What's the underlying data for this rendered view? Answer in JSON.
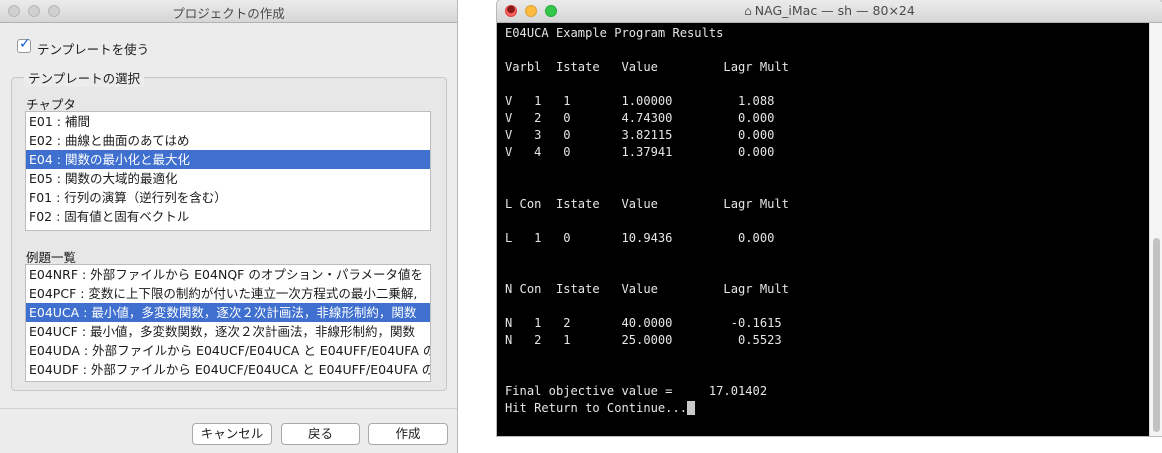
{
  "dialog": {
    "title": "プロジェクトの作成",
    "use_template_label": "テンプレートを使う",
    "use_template_checked": true,
    "template_group_title": "テンプレートの選択",
    "chapter_label": "チャプタ",
    "chapters": [
      "E01 : 補間",
      "E02 : 曲線と曲面のあてはめ",
      "E04 : 関数の最小化と最大化",
      "E05 : 関数の大域的最適化",
      "F01 : 行列の演算（逆行列を含む）",
      "F02 : 固有値と固有ベクトル"
    ],
    "chapter_selected_index": 2,
    "examples_label": "例題一覧",
    "examples": [
      "E04NRF : 外部ファイルから E04NQF のオプション・パラメータ値を",
      "E04PCF : 変数に上下限の制約が付いた連立一次方程式の最小二乗解,",
      "E04UCA : 最小値，多変数関数，逐次２次計画法，非線形制約，関数",
      "E04UCF : 最小値，多変数関数，逐次２次計画法，非線形制約，関数",
      "E04UDA : 外部ファイルから E04UCF/E04UCA と E04UFF/E04UFA の",
      "E04UDF : 外部ファイルから E04UCF/E04UCA と E04UFF/E04UFA の"
    ],
    "example_selected_index": 2,
    "buttons": {
      "cancel": "キャンセル",
      "back": "戻る",
      "create": "作成"
    }
  },
  "terminal": {
    "title": "NAG_iMac — sh — 80×24",
    "lines": [
      "E04UCA Example Program Results",
      "",
      "Varbl  Istate   Value         Lagr Mult",
      "",
      "V   1   1       1.00000         1.088",
      "V   2   0       4.74300         0.000",
      "V   3   0       3.82115         0.000",
      "V   4   0       1.37941         0.000",
      "",
      "",
      "L Con  Istate   Value         Lagr Mult",
      "",
      "L   1   0       10.9436         0.000",
      "",
      "",
      "N Con  Istate   Value         Lagr Mult",
      "",
      "N   1   2       40.0000        -0.1615",
      "N   2   1       25.0000         0.5523",
      "",
      "",
      "Final objective value =     17.01402",
      "Hit Return to Continue..."
    ]
  }
}
